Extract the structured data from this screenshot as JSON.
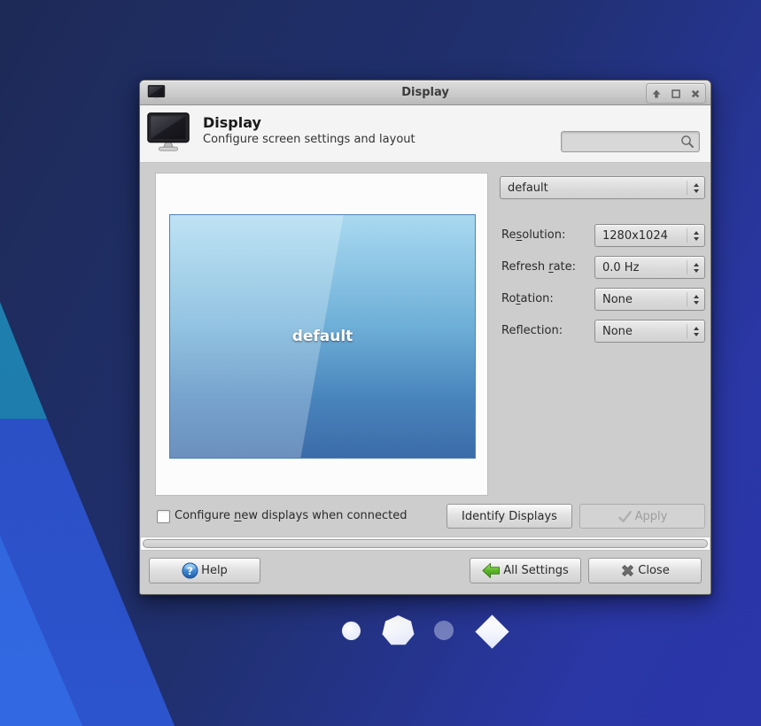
{
  "colors": {
    "help_icon_blue": "#3d85d1",
    "all_settings_green": "#5cb52c",
    "preview_blue_top": "#a9d9f0",
    "preview_blue_bottom": "#3b6ba8",
    "wallpaper_navy": "#1d2a57",
    "wallpaper_bright_blue": "#2b36a9",
    "wallpaper_cyan": "#1e7dad",
    "wallpaper_royal": "#2a49bd"
  },
  "icons": {
    "app": "monitor-icon",
    "search": "magnifier-icon",
    "shade": "up-arrow-icon",
    "maximize": "square-outline-icon",
    "close_window": "cross-icon",
    "help": "question-mark-circle-icon",
    "all_settings": "green-left-arrow-icon",
    "close_button": "gray-cross-icon",
    "apply": "checkmark-icon"
  },
  "titlebar": {
    "title": "Display"
  },
  "header": {
    "title": "Display",
    "subtitle": "Configure screen settings and layout",
    "search": {
      "value": ""
    }
  },
  "preview": {
    "display_name": "default"
  },
  "settings": {
    "profile": {
      "value": "default"
    },
    "rows": [
      {
        "label": {
          "pre": "Re",
          "mnemonic": "s",
          "post": "olution:"
        },
        "value": "1280x1024"
      },
      {
        "label": {
          "pre": "Refresh ",
          "mnemonic": "r",
          "post": "ate:"
        },
        "value": "0.0 Hz"
      },
      {
        "label": {
          "pre": "Ro",
          "mnemonic": "t",
          "post": "ation:"
        },
        "value": "None"
      },
      {
        "label": {
          "pre": "Ref",
          "mnemonic": "l",
          "post": "ection:"
        },
        "value": "None"
      }
    ]
  },
  "actions": {
    "configure_new_displays": {
      "checked": false,
      "label": {
        "pre": "Configure ",
        "mnemonic": "n",
        "post": "ew displays when connected"
      }
    },
    "identify_label": "Identify Displays",
    "apply_label": "Apply",
    "apply_enabled": false
  },
  "footer": {
    "help_label": "Help",
    "help_glyph": "?",
    "all_settings_label": "All Settings",
    "close_label": "Close"
  },
  "dock_shapes": [
    "circle",
    "heptagon",
    "dot",
    "diamond"
  ]
}
